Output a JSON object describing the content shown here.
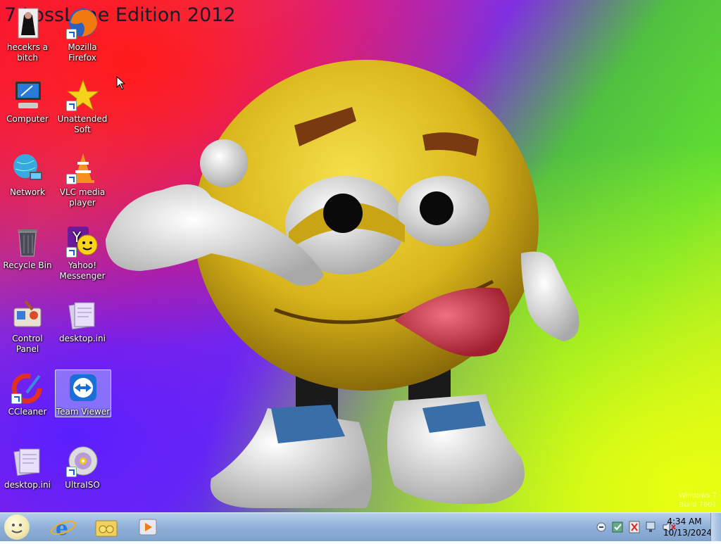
{
  "desktop": {
    "title_overlay": "7 LossLeae Edition 2012",
    "watermark_line1": "Windows 7",
    "watermark_line2": "Build 7601",
    "icons": [
      {
        "label": "hecekrs a bitch",
        "icon": "user-figure-icon"
      },
      {
        "label": "Mozilla Firefox",
        "icon": "firefox-icon"
      },
      {
        "label": "Computer",
        "icon": "computer-icon"
      },
      {
        "label": "Unattended Soft",
        "icon": "star-icon"
      },
      {
        "label": "Network",
        "icon": "network-globe-icon"
      },
      {
        "label": "VLC media player",
        "icon": "vlc-cone-icon"
      },
      {
        "label": "Recycle Bin",
        "icon": "recycle-bin-icon"
      },
      {
        "label": "Yahoo! Messenger",
        "icon": "yahoo-messenger-icon"
      },
      {
        "label": "Control Panel",
        "icon": "control-panel-icon"
      },
      {
        "label": "desktop.ini",
        "icon": "ini-file-icon"
      },
      {
        "label": "CCleaner",
        "icon": "ccleaner-icon"
      },
      {
        "label": "Team Viewer",
        "icon": "teamviewer-icon"
      },
      {
        "label": "desktop.ini",
        "icon": "ini-file-icon"
      },
      {
        "label": "UltraISO",
        "icon": "disc-icon"
      }
    ]
  },
  "taskbar": {
    "start_icon": "smiley-orb-icon",
    "pinned": [
      {
        "name": "Internet Explorer",
        "icon": "ie-icon"
      },
      {
        "name": "Libraries",
        "icon": "folder-icon"
      },
      {
        "name": "Media Player",
        "icon": "media-player-icon"
      }
    ],
    "tray_icons": [
      "show-hidden-icon",
      "security-icon",
      "action-center-icon",
      "network-icon",
      "volume-muted-icon"
    ],
    "time": "4:34 AM",
    "date": "10/13/2024"
  }
}
